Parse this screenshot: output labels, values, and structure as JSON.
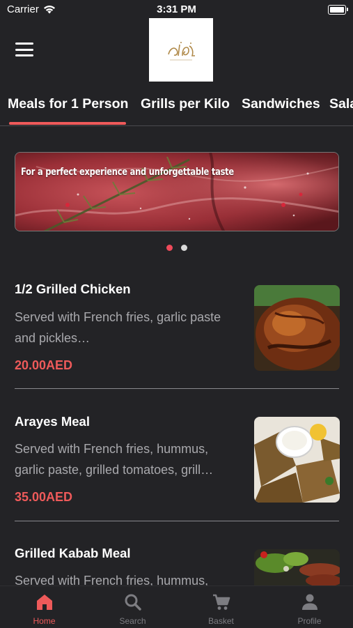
{
  "status_bar": {
    "carrier": "Carrier",
    "time": "3:31 PM"
  },
  "tabs": [
    {
      "label": "Meals for 1 Person",
      "active": true
    },
    {
      "label": "Grills per Kilo",
      "active": false
    },
    {
      "label": "Sandwiches",
      "active": false
    },
    {
      "label": "Sala",
      "active": false
    }
  ],
  "banner": {
    "text": "For a perfect experience and unforgettable taste",
    "page_count": 2,
    "current_page": 1
  },
  "menu_items": [
    {
      "title": "1/2 Grilled Chicken",
      "description": "Served with French fries, garlic paste and pickles…",
      "price": "20.00AED"
    },
    {
      "title": "Arayes Meal",
      "description": "Served with French fries, hummus, garlic paste, grilled tomatoes, grill…",
      "price": "35.00AED"
    },
    {
      "title": "Grilled Kabab Meal",
      "description": "Served with French fries, hummus,",
      "price": ""
    }
  ],
  "bottom_nav": [
    {
      "label": "Home",
      "icon": "home-icon",
      "active": true
    },
    {
      "label": "Search",
      "icon": "search-icon",
      "active": false
    },
    {
      "label": "Basket",
      "icon": "cart-icon",
      "active": false
    },
    {
      "label": "Profile",
      "icon": "person-icon",
      "active": false
    }
  ],
  "colors": {
    "background": "#232326",
    "accent": "#ee5a5a",
    "text_primary": "#ffffff",
    "text_secondary": "#a9a9ad",
    "nav_inactive": "#7d7d82"
  }
}
